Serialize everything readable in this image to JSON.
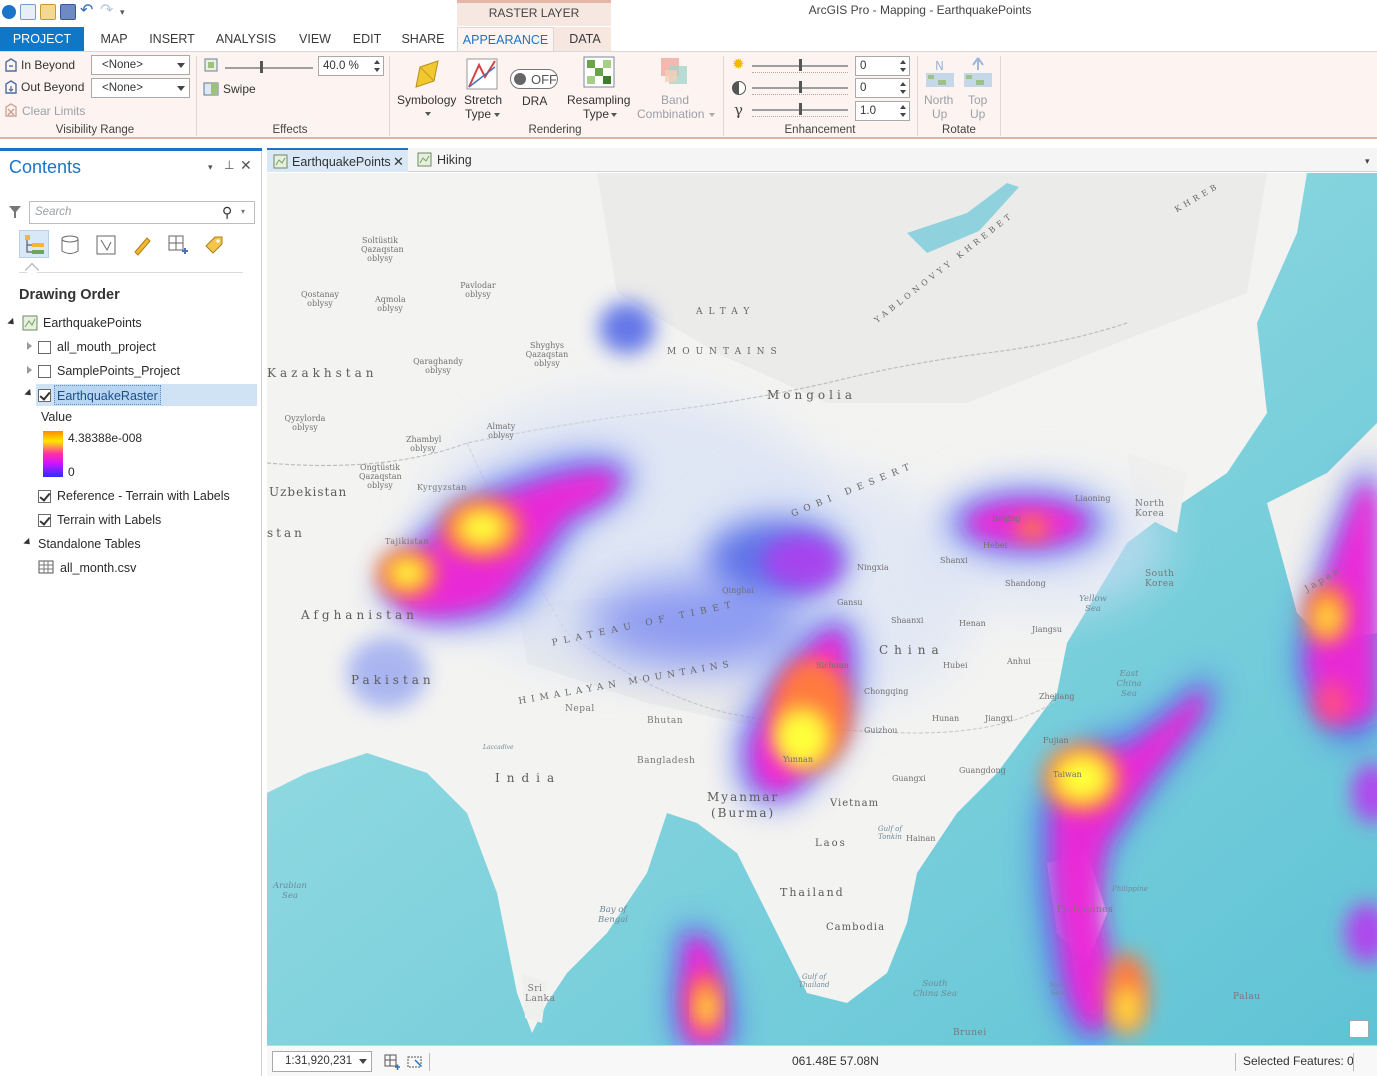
{
  "app": {
    "title": "ArcGIS Pro - Mapping - EarthquakePoints",
    "contextual_header": "RASTER LAYER"
  },
  "ribbon_tabs": [
    "PROJECT",
    "MAP",
    "INSERT",
    "ANALYSIS",
    "VIEW",
    "EDIT",
    "SHARE",
    "APPEARANCE",
    "DATA"
  ],
  "ribbon": {
    "visibility_range": {
      "label": "Visibility Range",
      "in_beyond": "In Beyond",
      "out_beyond": "Out Beyond",
      "clear_limits": "Clear Limits",
      "in_beyond_value": "<None>",
      "out_beyond_value": "<None>"
    },
    "effects": {
      "label": "Effects",
      "transparency_value": "40.0 %",
      "transparency_level": 0.4,
      "swipe": "Swipe"
    },
    "rendering": {
      "label": "Rendering",
      "symbology": "Symbology",
      "stretch_type_1": "Stretch",
      "stretch_type_2": "Type",
      "dra_toggle": "OFF",
      "dra": "DRA",
      "resampling_1": "Resampling",
      "resampling_2": "Type",
      "band_combination_1": "Band",
      "band_combination_2": "Combination"
    },
    "enhancement": {
      "label": "Enhancement",
      "brightness": "0",
      "contrast": "0",
      "gamma": "1.0"
    },
    "rotate": {
      "label": "Rotate",
      "north_up_1": "North",
      "north_up_2": "Up",
      "top_up_1": "Top",
      "top_up_2": "Up"
    }
  },
  "contents": {
    "title": "Contents",
    "search_placeholder": "Search",
    "drawing_order": "Drawing Order",
    "map_name": "EarthquakePoints",
    "layers": [
      {
        "name": "all_mouth_project",
        "checked": false
      },
      {
        "name": "SamplePoints_Project",
        "checked": false
      },
      {
        "name": "EarthquakeRaster",
        "checked": true
      }
    ],
    "legend": {
      "title": "Value",
      "max": "4.38388e-008",
      "min": "0"
    },
    "basemaps": [
      {
        "name": "Reference - Terrain with Labels",
        "checked": true
      },
      {
        "name": "Terrain with Labels",
        "checked": true
      }
    ],
    "standalone_tables": "Standalone Tables",
    "table_name": "all_month.csv"
  },
  "map_tabs": [
    "EarthquakePoints",
    "Hiking"
  ],
  "statusbar": {
    "scale": "1:31,920,231",
    "coordinates": "061.48E 57.08N",
    "selected": "Selected Features: 0"
  },
  "map_labels": {
    "countries": [
      "Kazakhstan",
      "Mongolia",
      "Uzbekistan",
      "Afghanistan",
      "Pakistan",
      "India",
      "China",
      "Myanmar",
      "(Burma)",
      "Thailand",
      "Laos",
      "Vietnam",
      "Cambodia",
      "Nepal",
      "Bhutan",
      "Bangladesh",
      "Sri Lanka",
      "North Korea",
      "South Korea",
      "Japan",
      "Philippines",
      "Brunei",
      "Palau",
      "Tajikistan",
      "Kyrgyzstan",
      "stan"
    ],
    "regions": [
      "Soltüstik Qazaqstan oblysy",
      "Qostanay oblysy",
      "Aqmola oblysy",
      "Pavlodar oblysy",
      "Shyghys Qazaqstan oblysy",
      "Qaraghandy oblysy",
      "Qyzylorda oblysy",
      "Almaty oblysy",
      "Zhambyl oblysy",
      "Ongtüstik Qazaqstan oblysy",
      "Beijing",
      "Hebei",
      "Shanxi",
      "Shandong",
      "Liaoning",
      "Ningxia",
      "Gansu",
      "Qinghai",
      "Shaanxi",
      "Henan",
      "Jiangsu",
      "Anhui",
      "Hubei",
      "Sichuan",
      "Chongqing",
      "Zhejiang",
      "Hunan",
      "Jiangxi",
      "Fujian",
      "Guizhou",
      "Yunnan",
      "Guangxi",
      "Guangdong",
      "Taiwan",
      "Hainan"
    ],
    "physical": [
      "ALTAY",
      "MOUNTAINS",
      "GOBI DESERT",
      "PLATEAU OF TIBET",
      "HIMALAYAN MOUNTAINS",
      "YABLONOVYY KHREBET",
      "KHREB"
    ],
    "seas": [
      "Yellow Sea",
      "East China Sea",
      "South China Sea",
      "Bay of Bengal",
      "Arabian Sea",
      "Gulf of Tonkin",
      "Gulf of Thailand",
      "Sulu Sea",
      "Philippine",
      "Laccadive"
    ]
  },
  "colors": {
    "accent": "#1b74c7",
    "ribbon_bg": "#fdf4f1",
    "heat_low": "#4b62e6",
    "heat_mid": "#ff1fd4",
    "heat_high": "#ffff3a",
    "ocean": "#7fd3df"
  }
}
